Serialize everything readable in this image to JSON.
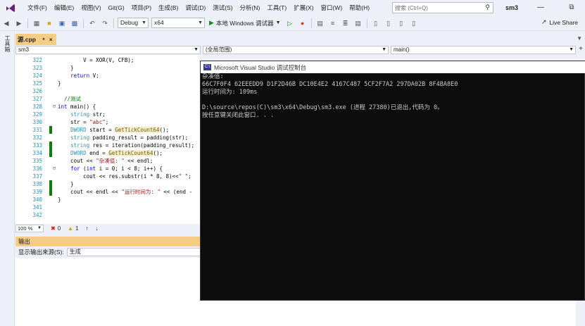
{
  "menubar": {
    "items": [
      "文件(F)",
      "编辑(E)",
      "视图(V)",
      "Git(G)",
      "项目(P)",
      "生成(B)",
      "调试(D)",
      "测试(S)",
      "分析(N)",
      "工具(T)",
      "扩展(X)",
      "窗口(W)",
      "帮助(H)"
    ],
    "search_placeholder": "搜索 (Ctrl+Q)",
    "solution_name": "sm3"
  },
  "toolbar": {
    "config": "Debug",
    "platform": "x64",
    "run_label": "本地 Windows 调试器",
    "live_share": "Live Share"
  },
  "left_strip": {
    "label": "工具箱"
  },
  "editor": {
    "tab_name": "源.cpp",
    "nav_project": "sm3",
    "nav_scope": "(全局范围)",
    "nav_member": "main()",
    "zoom": "100 %",
    "errors": "0",
    "warnings": "1",
    "lines": [
      {
        "no": "322",
        "text": "        V = XOR(V, CFB);"
      },
      {
        "no": "323",
        "text": "    }"
      },
      {
        "no": "324",
        "text": "    return V;"
      },
      {
        "no": "325",
        "text": "}"
      },
      {
        "no": "326",
        "text": ""
      },
      {
        "no": "327",
        "text": "//测试"
      },
      {
        "no": "328",
        "text": "int main() {"
      },
      {
        "no": "329",
        "text": "    string str;"
      },
      {
        "no": "330",
        "text": "    str = \"abc\";"
      },
      {
        "no": "331",
        "text": "    DWORD start = GetTickCount64();"
      },
      {
        "no": "332",
        "text": "    string padding_result = padding(str);"
      },
      {
        "no": "333",
        "text": "    string res = iteration(padding_result);"
      },
      {
        "no": "334",
        "text": "    DWORD end = GetTickCount64();"
      },
      {
        "no": "335",
        "text": "    cout << \"杂凑值: \" << endl;"
      },
      {
        "no": "336",
        "text": "    for (int i = 0; i < 8; i++) {"
      },
      {
        "no": "337",
        "text": "        cout << res.substr(i * 8, 8)<<\" \";"
      },
      {
        "no": "338",
        "text": "    }"
      },
      {
        "no": "339",
        "text": "    cout << endl << \"运行时间为: \" << (end -"
      },
      {
        "no": "340",
        "text": "}"
      },
      {
        "no": "341",
        "text": ""
      },
      {
        "no": "342",
        "text": ""
      }
    ]
  },
  "output": {
    "title": "输出",
    "source_label": "显示输出来源(S):",
    "source_value": "生成"
  },
  "console": {
    "title": "Microsoft Visual Studio 调试控制台",
    "lines": [
      "杂凑值:",
      "66C7F0F4 62EEEDD9 D1F2D46B DC10E4E2 4167C487 5CF2F7A2 297DA02B 8F4BA8E0",
      "运行时间为: 109ms",
      "",
      "D:\\source\\repos(C)\\sm3\\x64\\Debug\\sm3.exe (进程 27380)已退出,代码为 0。",
      "按任意键关闭此窗口. . ."
    ]
  }
}
